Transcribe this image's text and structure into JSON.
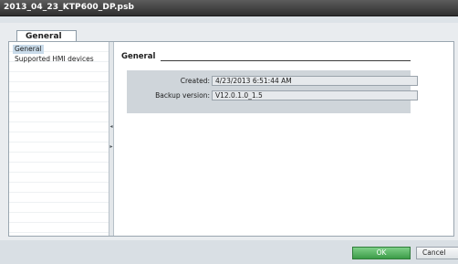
{
  "window": {
    "title": "2013_04_23_KTP600_DP.psb"
  },
  "tabs": [
    {
      "label": "General"
    }
  ],
  "nav": {
    "items": [
      {
        "label": "General",
        "selected": true
      },
      {
        "label": "Supported HMI devices",
        "selected": false
      }
    ]
  },
  "section": {
    "title": "General",
    "fields": [
      {
        "label": "Created:",
        "value": "4/23/2013 6:51:44 AM"
      },
      {
        "label": "Backup version:",
        "value": "V12.0.1.0_1.5"
      }
    ]
  },
  "footer": {
    "ok_label": "OK",
    "cancel_label": "Cancel"
  },
  "colors": {
    "ok_button": "#4aa856",
    "title_bar": "#3a3a3a",
    "selection": "#c9dbea"
  }
}
